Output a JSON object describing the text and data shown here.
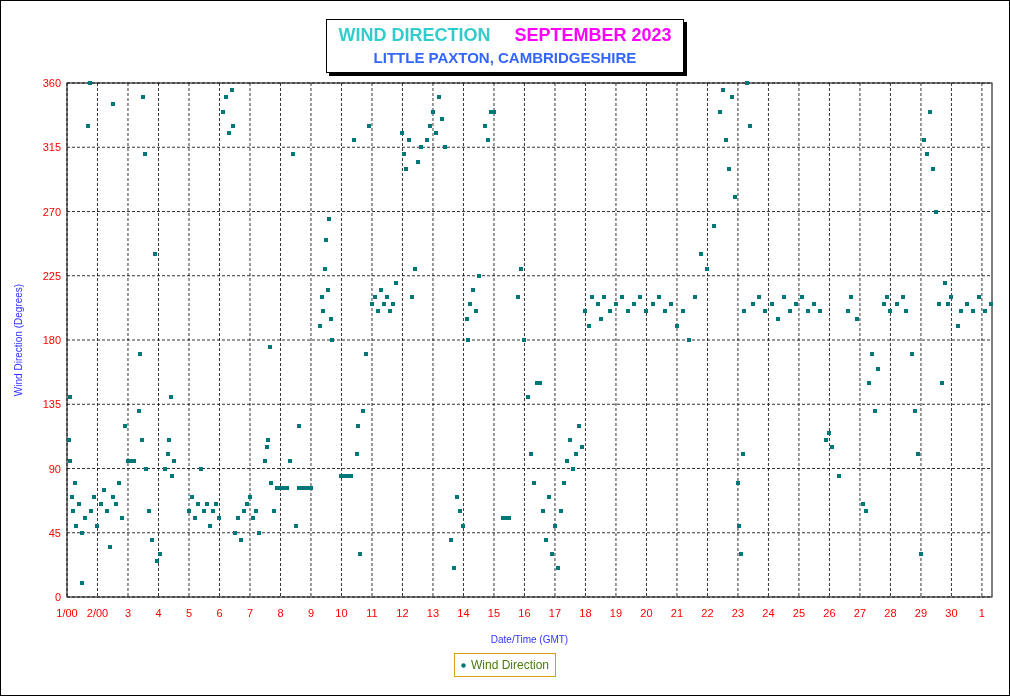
{
  "title": {
    "parts": [
      "WIND DIRECTION",
      "SEPTEMBER 2023"
    ],
    "subtitle": "LITTLE PAXTON, CAMBRIDGESHIRE"
  },
  "chart": {
    "next_month_tick": "1",
    "chart_data": {
      "type": "scatter",
      "xlabel": "Date/Time (GMT)",
      "ylabel": "Wind Direction (Degrees)",
      "xlim": [
        1,
        31.33
      ],
      "ylim": [
        0,
        360
      ],
      "xticks": [
        {
          "value": 1,
          "label": "1/00"
        },
        {
          "value": 2,
          "label": "2/00"
        },
        {
          "value": 3,
          "label": "3"
        },
        {
          "value": 4,
          "label": "4"
        },
        {
          "value": 5,
          "label": "5"
        },
        {
          "value": 6,
          "label": "6"
        },
        {
          "value": 7,
          "label": "7"
        },
        {
          "value": 8,
          "label": "8"
        },
        {
          "value": 9,
          "label": "9"
        },
        {
          "value": 10,
          "label": "10"
        },
        {
          "value": 11,
          "label": "11"
        },
        {
          "value": 12,
          "label": "12"
        },
        {
          "value": 13,
          "label": "13"
        },
        {
          "value": 14,
          "label": "14"
        },
        {
          "value": 15,
          "label": "15"
        },
        {
          "value": 16,
          "label": "16"
        },
        {
          "value": 17,
          "label": "17"
        },
        {
          "value": 18,
          "label": "18"
        },
        {
          "value": 19,
          "label": "19"
        },
        {
          "value": 20,
          "label": "20"
        },
        {
          "value": 21,
          "label": "21"
        },
        {
          "value": 22,
          "label": "22"
        },
        {
          "value": 23,
          "label": "23"
        },
        {
          "value": 24,
          "label": "24"
        },
        {
          "value": 25,
          "label": "25"
        },
        {
          "value": 26,
          "label": "26"
        },
        {
          "value": 27,
          "label": "27"
        },
        {
          "value": 28,
          "label": "28"
        },
        {
          "value": 29,
          "label": "29"
        },
        {
          "value": 30,
          "label": "30"
        }
      ],
      "grid": true,
      "yticks": [
        0,
        45,
        90,
        135,
        180,
        225,
        270,
        315,
        360
      ],
      "x": [
        1.05,
        1.1,
        1.15,
        1.2,
        1.25,
        1.1,
        1.3,
        1.4,
        1.5,
        1.6,
        1.7,
        1.75,
        1.8,
        1.9,
        2.0,
        2.1,
        2.2,
        2.3,
        2.4,
        2.5,
        2.6,
        2.7,
        2.8,
        2.5,
        1.5,
        2.9,
        3.0,
        3.1,
        3.2,
        3.35,
        3.4,
        3.45,
        3.5,
        3.55,
        3.6,
        3.7,
        3.8,
        3.9,
        3.95,
        4.05,
        4.2,
        4.3,
        4.35,
        4.4,
        4.45,
        4.5,
        5.0,
        5.1,
        5.2,
        5.3,
        5.4,
        5.5,
        5.6,
        5.7,
        5.8,
        5.9,
        6.0,
        6.1,
        6.2,
        6.3,
        6.4,
        6.45,
        6.5,
        6.6,
        6.7,
        6.8,
        6.9,
        7.0,
        7.1,
        7.2,
        7.3,
        7.5,
        7.55,
        7.6,
        7.65,
        7.7,
        7.8,
        7.9,
        8.0,
        8.1,
        8.2,
        8.3,
        8.4,
        8.5,
        8.6,
        8.7,
        8.8,
        8.9,
        9.0,
        8.6,
        9.3,
        9.35,
        9.4,
        9.45,
        9.5,
        9.55,
        9.6,
        9.65,
        9.7,
        10.0,
        10.1,
        10.2,
        10.3,
        10.4,
        10.5,
        10.55,
        10.6,
        10.7,
        10.8,
        10.9,
        11.0,
        11.1,
        11.2,
        11.3,
        11.4,
        11.5,
        11.6,
        11.7,
        11.8,
        12.0,
        12.05,
        12.1,
        12.2,
        12.3,
        12.4,
        12.5,
        12.6,
        12.8,
        12.9,
        13.0,
        13.1,
        13.2,
        13.3,
        13.4,
        13.6,
        13.7,
        13.8,
        13.9,
        14.0,
        14.1,
        14.15,
        14.2,
        14.3,
        14.4,
        14.5,
        14.7,
        14.8,
        14.9,
        15.0,
        15.3,
        15.4,
        15.5,
        15.8,
        15.9,
        16.0,
        16.1,
        16.2,
        16.3,
        16.4,
        16.5,
        16.6,
        16.7,
        16.8,
        16.9,
        17.0,
        17.1,
        17.2,
        17.3,
        17.4,
        17.5,
        17.6,
        17.7,
        17.8,
        17.9,
        18.0,
        18.1,
        18.2,
        18.4,
        18.5,
        18.6,
        18.8,
        19.0,
        19.2,
        19.4,
        19.6,
        19.8,
        20.0,
        20.2,
        20.4,
        20.6,
        20.8,
        21.0,
        21.2,
        21.4,
        21.6,
        21.8,
        22.0,
        22.2,
        22.4,
        22.5,
        22.6,
        22.7,
        22.8,
        22.9,
        23.0,
        23.05,
        23.1,
        23.15,
        23.2,
        23.3,
        23.4,
        23.5,
        23.7,
        23.9,
        24.1,
        24.3,
        24.5,
        24.7,
        24.9,
        25.1,
        25.3,
        25.5,
        25.7,
        25.9,
        26.0,
        26.1,
        26.3,
        26.6,
        26.7,
        26.9,
        27.1,
        27.2,
        27.3,
        27.4,
        27.5,
        27.6,
        27.8,
        27.9,
        28.0,
        28.2,
        28.4,
        28.5,
        28.7,
        28.8,
        28.9,
        29.0,
        29.1,
        29.2,
        29.3,
        29.4,
        29.5,
        29.6,
        29.7,
        29.8,
        29.9,
        30.0,
        30.2,
        30.3,
        30.5,
        30.7,
        30.9,
        31.1,
        31.3
      ],
      "series": [
        {
          "name": "Wind Direction",
          "color": "#007878",
          "values": [
            110,
            95,
            70,
            60,
            80,
            140,
            50,
            65,
            45,
            55,
            330,
            360,
            60,
            70,
            50,
            65,
            75,
            60,
            35,
            70,
            65,
            80,
            55,
            345,
            10,
            120,
            95,
            95,
            95,
            130,
            170,
            110,
            350,
            310,
            90,
            60,
            40,
            240,
            25,
            30,
            90,
            100,
            110,
            140,
            85,
            95,
            60,
            70,
            55,
            65,
            90,
            60,
            65,
            50,
            60,
            65,
            55,
            340,
            350,
            325,
            355,
            330,
            45,
            55,
            40,
            60,
            65,
            70,
            55,
            60,
            45,
            95,
            105,
            110,
            175,
            80,
            60,
            76,
            76,
            76,
            76,
            95,
            310,
            50,
            76,
            76,
            76,
            76,
            76,
            120,
            190,
            210,
            200,
            230,
            250,
            215,
            265,
            195,
            180,
            85,
            85,
            85,
            85,
            320,
            100,
            120,
            30,
            130,
            170,
            330,
            205,
            210,
            200,
            215,
            205,
            210,
            200,
            205,
            220,
            325,
            310,
            300,
            320,
            210,
            230,
            305,
            315,
            320,
            330,
            340,
            325,
            350,
            335,
            315,
            40,
            20,
            70,
            60,
            50,
            195,
            180,
            205,
            215,
            200,
            225,
            330,
            320,
            340,
            340,
            55,
            55,
            55,
            210,
            230,
            180,
            140,
            100,
            80,
            150,
            150,
            60,
            40,
            70,
            30,
            50,
            20,
            60,
            80,
            95,
            110,
            90,
            100,
            120,
            105,
            200,
            190,
            210,
            205,
            195,
            210,
            200,
            205,
            210,
            200,
            205,
            210,
            200,
            205,
            210,
            200,
            205,
            190,
            200,
            180,
            210,
            240,
            230,
            260,
            340,
            355,
            320,
            300,
            350,
            280,
            80,
            50,
            30,
            100,
            200,
            360,
            330,
            205,
            210,
            200,
            205,
            195,
            210,
            200,
            205,
            210,
            200,
            205,
            200,
            110,
            115,
            105,
            85,
            200,
            210,
            195,
            65,
            60,
            150,
            170,
            130,
            160,
            205,
            210,
            200,
            205,
            210,
            200,
            170,
            130,
            100,
            30,
            320,
            310,
            340,
            300,
            270,
            205,
            150,
            220,
            205,
            210,
            190,
            200,
            205,
            200,
            210,
            200,
            205
          ]
        }
      ]
    }
  }
}
